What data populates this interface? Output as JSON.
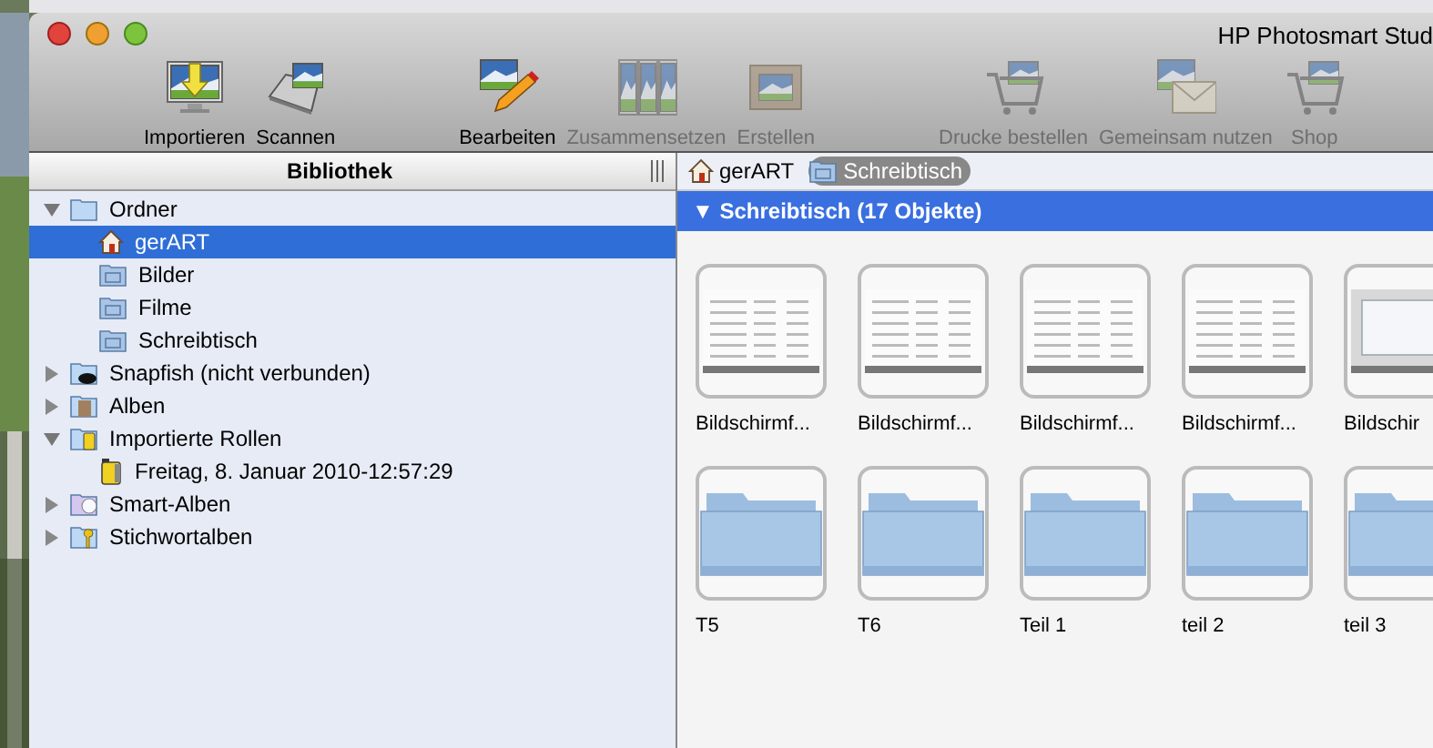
{
  "window": {
    "title": "HP Photosmart Stud"
  },
  "toolbar": [
    {
      "label": "Importieren",
      "kind": "import",
      "disabled": false
    },
    {
      "label": "Scannen",
      "kind": "scan",
      "disabled": false
    },
    {
      "label": "Bearbeiten",
      "kind": "edit",
      "disabled": false
    },
    {
      "label": "Zusammensetzen",
      "kind": "compose",
      "disabled": true
    },
    {
      "label": "Erstellen",
      "kind": "create",
      "disabled": true
    },
    {
      "label": "Drucke bestellen",
      "kind": "order",
      "disabled": true
    },
    {
      "label": "Gemeinsam nutzen",
      "kind": "share",
      "disabled": true
    },
    {
      "label": "Shop",
      "kind": "shop",
      "disabled": true
    }
  ],
  "sidebar": {
    "title": "Bibliothek",
    "items": [
      {
        "label": "Ordner",
        "kind": "folders",
        "expanded": true,
        "selected": false,
        "children": [
          {
            "label": "gerART",
            "kind": "home",
            "selected": true
          },
          {
            "label": "Bilder",
            "kind": "folder",
            "selected": false
          },
          {
            "label": "Filme",
            "kind": "folder",
            "selected": false
          },
          {
            "label": "Schreibtisch",
            "kind": "folder",
            "selected": false
          }
        ]
      },
      {
        "label": "Snapfish (nicht verbunden)",
        "kind": "snapfish",
        "expanded": false,
        "selected": false
      },
      {
        "label": "Alben",
        "kind": "albums",
        "expanded": false,
        "selected": false
      },
      {
        "label": "Importierte Rollen",
        "kind": "rolls",
        "expanded": true,
        "selected": false,
        "children": [
          {
            "label": "Freitag, 8. Januar 2010-12:57:29",
            "kind": "roll",
            "selected": false
          }
        ]
      },
      {
        "label": "Smart-Alben",
        "kind": "smart",
        "expanded": false,
        "selected": false
      },
      {
        "label": "Stichwortalben",
        "kind": "keywords",
        "expanded": false,
        "selected": false
      }
    ]
  },
  "breadcrumb": [
    {
      "label": "gerART",
      "kind": "home",
      "selected": false
    },
    {
      "label": "Schreibtisch",
      "kind": "folder",
      "selected": true
    }
  ],
  "content": {
    "header": "▼ Schreibtisch (17 Objekte)",
    "items": [
      {
        "label": "Bildschirmf..."
      },
      {
        "label": "Bildschirmf..."
      },
      {
        "label": "Bildschirmf..."
      },
      {
        "label": "Bildschirmf..."
      },
      {
        "label": "Bildschir",
        "kind": "window"
      },
      {
        "label": "T5",
        "kind": "folder"
      },
      {
        "label": "T6",
        "kind": "folder"
      },
      {
        "label": "Teil 1",
        "kind": "folder"
      },
      {
        "label": "teil 2",
        "kind": "folder"
      },
      {
        "label": "teil 3",
        "kind": "folder"
      }
    ]
  }
}
